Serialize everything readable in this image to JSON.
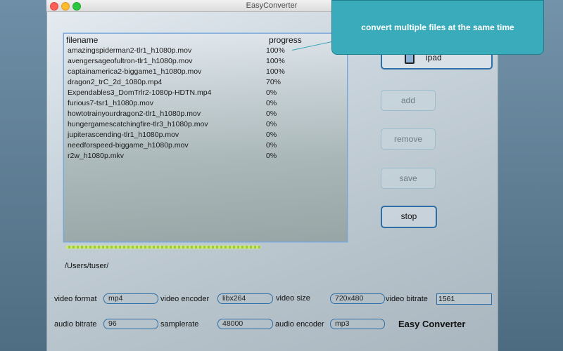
{
  "window": {
    "title": "EasyConverter"
  },
  "tooltip": {
    "text": "convert multiple files at the same time"
  },
  "list": {
    "headers": {
      "filename": "filename",
      "progress": "progress"
    },
    "rows": [
      {
        "filename": "amazingspiderman2-tlr1_h1080p.mov",
        "progress": "100%"
      },
      {
        "filename": "avengersageofultron-tlr1_h1080p.mov",
        "progress": "100%"
      },
      {
        "filename": "captainamerica2-biggame1_h1080p.mov",
        "progress": "100%"
      },
      {
        "filename": "dragon2_trC_2d_1080p.mp4",
        "progress": "70%"
      },
      {
        "filename": "Expendables3_DomTrlr2-1080p-HDTN.mp4",
        "progress": "0%"
      },
      {
        "filename": "furious7-tsr1_h1080p.mov",
        "progress": "0%"
      },
      {
        "filename": "howtotrainyourdragon2-tlr1_h1080p.mov",
        "progress": "0%"
      },
      {
        "filename": "hungergamescatchingfire-tlr3_h1080p.mov",
        "progress": "0%"
      },
      {
        "filename": "jupiterascending-tlr1_h1080p.mov",
        "progress": "0%"
      },
      {
        "filename": "needforspeed-biggame_h1080p.mov",
        "progress": "0%"
      },
      {
        "filename": "r2w_h1080p.mkv",
        "progress": "0%"
      }
    ]
  },
  "output_path": "/Users/tuser/",
  "buttons": {
    "device": "ipad",
    "add": "add",
    "remove": "remove",
    "save": "save",
    "stop": "stop"
  },
  "settings": {
    "video_format_label": "video format",
    "video_format": "mp4",
    "video_encoder_label": "video encoder",
    "video_encoder": "libx264",
    "video_size_label": "video size",
    "video_size": "720x480",
    "video_bitrate_label": "video bitrate",
    "video_bitrate": "1561",
    "audio_bitrate_label": "audio bitrate",
    "audio_bitrate": "96",
    "samplerate_label": "samplerate",
    "samplerate": "48000",
    "audio_encoder_label": "audio encoder",
    "audio_encoder": "mp3"
  },
  "brand": "Easy Converter",
  "colors": {
    "accent": "#2f6fa8",
    "tooltip": "#3aabba",
    "progress": "#c8e86a"
  }
}
